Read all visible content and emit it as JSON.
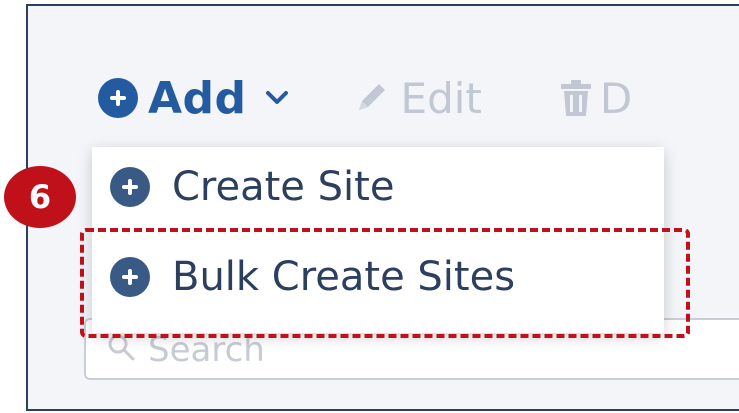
{
  "toolbar": {
    "add_label": "Add",
    "edit_label": "Edit",
    "delete_label_partial": "D"
  },
  "search": {
    "placeholder_partial": "Search"
  },
  "add_menu": {
    "items": [
      {
        "label": "Create Site",
        "icon": "plus-circle-icon"
      },
      {
        "label": "Bulk Create Sites",
        "icon": "plus-circle-icon"
      }
    ]
  },
  "annotation": {
    "step_number": "6",
    "highlighted_item": "Bulk Create Sites"
  },
  "colors": {
    "accent": "#235aa0",
    "annotation_red": "#c0111a",
    "disabled": "#c1c8d3",
    "frame_border": "#2b3f63"
  }
}
